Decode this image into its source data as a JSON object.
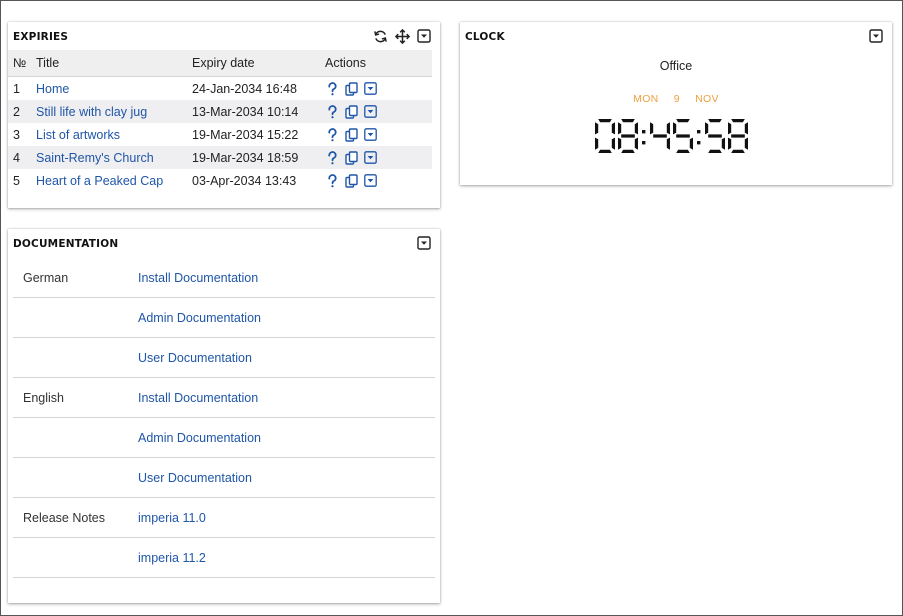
{
  "expiries": {
    "title": "EXPIRIES",
    "columns": {
      "no": "№",
      "title": "Title",
      "expiry": "Expiry date",
      "actions": "Actions"
    },
    "rows": [
      {
        "no": "1",
        "title": "Home",
        "date": "24-Jan-2034 16:48"
      },
      {
        "no": "2",
        "title": "Still life with clay jug",
        "date": "13-Mar-2034 10:14"
      },
      {
        "no": "3",
        "title": "List of artworks",
        "date": "19-Mar-2034 15:22"
      },
      {
        "no": "4",
        "title": "Saint-Remy's Church",
        "date": "19-Mar-2034 18:59"
      },
      {
        "no": "5",
        "title": "Heart of a Peaked Cap",
        "date": "03-Apr-2034 13:43"
      }
    ],
    "tools": [
      "refresh-icon",
      "move-icon",
      "dropdown-icon"
    ],
    "row_actions": [
      "help-icon",
      "copy-icon",
      "dropdown-icon"
    ]
  },
  "clock": {
    "title": "CLOCK",
    "label": "Office",
    "day": "MON",
    "date": "9",
    "month": "NOV",
    "time": "08:45:58"
  },
  "documentation": {
    "title": "DOCUMENTATION",
    "rows": [
      {
        "lang": "German",
        "link": "Install Documentation"
      },
      {
        "lang": "",
        "link": "Admin Documentation"
      },
      {
        "lang": "",
        "link": "User Documentation"
      },
      {
        "lang": "English",
        "link": "Install Documentation"
      },
      {
        "lang": "",
        "link": "Admin Documentation"
      },
      {
        "lang": "",
        "link": "User Documentation"
      },
      {
        "lang": "Release Notes",
        "link": "imperia 11.0"
      },
      {
        "lang": "",
        "link": "imperia 11.2"
      }
    ]
  },
  "colors": {
    "link": "#1f56a8",
    "accent": "#f0a040",
    "alt_row": "#efeef0"
  }
}
